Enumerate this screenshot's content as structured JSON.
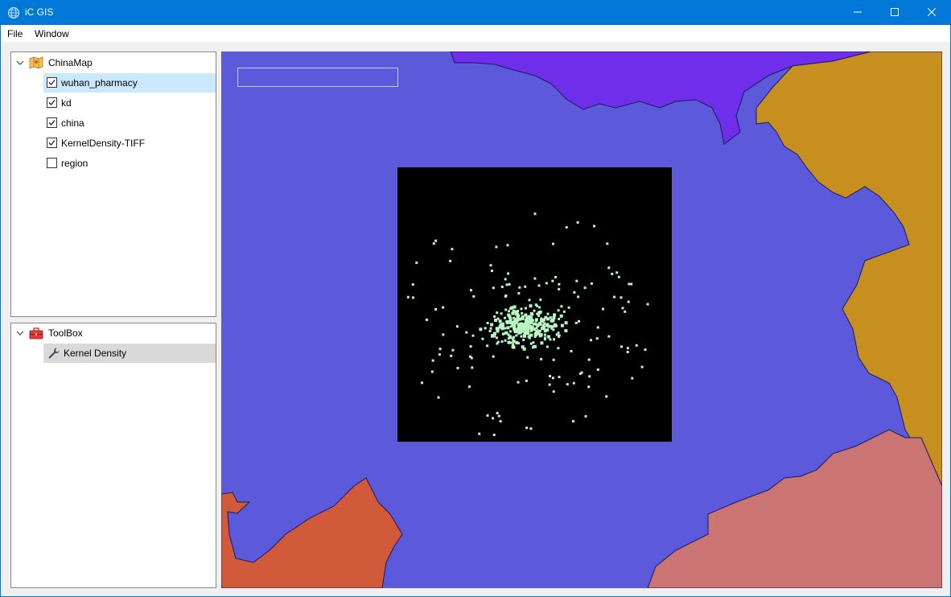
{
  "window": {
    "title": "iC GIS"
  },
  "menu": {
    "items": [
      "File",
      "Window"
    ]
  },
  "layers_panel": {
    "root_label": "ChinaMap",
    "layers": [
      {
        "label": "wuhan_pharmacy",
        "checked": true,
        "selected": true
      },
      {
        "label": "kd",
        "checked": true,
        "selected": false
      },
      {
        "label": "china",
        "checked": true,
        "selected": false
      },
      {
        "label": "KernelDensity-TIFF",
        "checked": true,
        "selected": false
      },
      {
        "label": "region",
        "checked": false,
        "selected": false
      }
    ]
  },
  "toolbox_panel": {
    "root_label": "ToolBox",
    "tools": [
      {
        "label": "Kernel Density"
      }
    ]
  },
  "map": {
    "search_value": "",
    "colors": {
      "hubei": "#5c5adb",
      "henan": "#6f2eea",
      "anhui": "#c68f20",
      "hunan": "#d05a3a",
      "jiangxi": "#ca7474",
      "raster_bg": "#000000",
      "points": "#b8f7c4"
    }
  }
}
